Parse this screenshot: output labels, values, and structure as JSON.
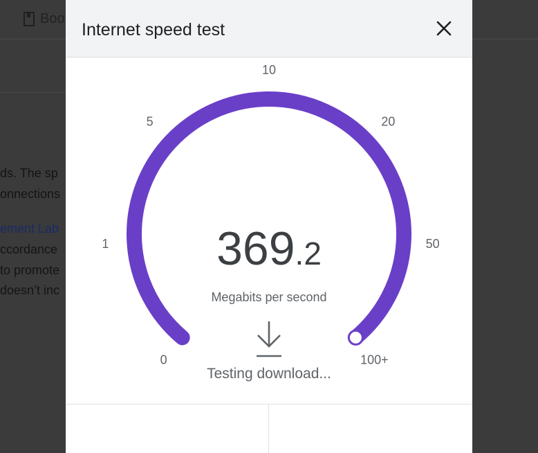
{
  "background": {
    "bookmark_text": "Boo",
    "lines": [
      {
        "text": "ds. The sp",
        "link": false
      },
      {
        "text": "onnections",
        "link": false
      },
      {
        "text": "ement Lab",
        "link": true
      },
      {
        "text": "ccordance",
        "link": false
      },
      {
        "text": "to promote",
        "link": false
      },
      {
        "text": "doesn’t inc",
        "link": false
      }
    ]
  },
  "dialog": {
    "title": "Internet speed test",
    "close_icon": "close-icon"
  },
  "gauge": {
    "scale_labels": [
      "0",
      "1",
      "5",
      "10",
      "20",
      "50",
      "100+"
    ],
    "progress_fraction": 1.0,
    "accent_color": "#6a3fc7",
    "value_integer": "369",
    "value_decimal": ".2",
    "unit": "Megabits per second"
  },
  "status": {
    "icon": "download-arrow-icon",
    "text": "Testing download..."
  }
}
